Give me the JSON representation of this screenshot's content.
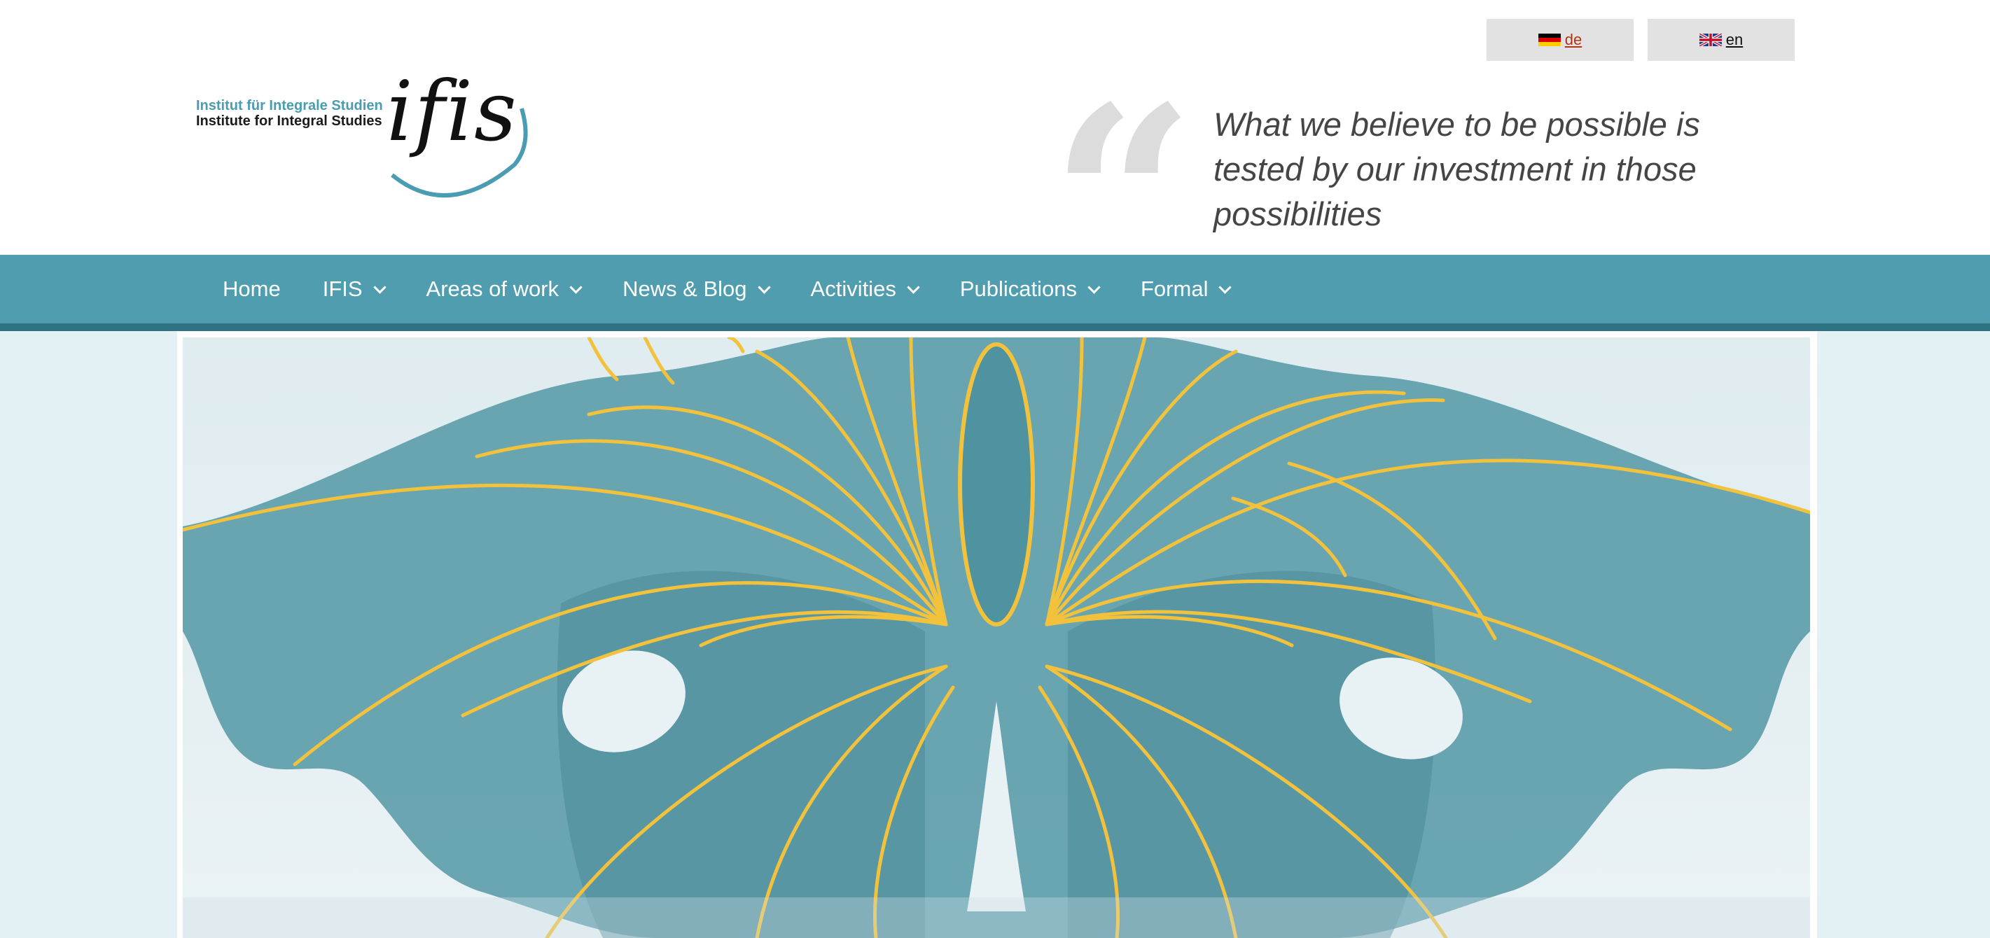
{
  "language_switcher": {
    "de": {
      "label": " de",
      "flag": "germany-flag-icon"
    },
    "en": {
      "label": " en",
      "flag": "uk-flag-icon"
    }
  },
  "logo": {
    "line1": "Institut für Integrale Studien",
    "line2": "Institute for Integral Studies",
    "mark": "ifis"
  },
  "quote": {
    "mark": "“",
    "text": "What we believe to be possible is tested by our investment in those possibilities"
  },
  "nav": {
    "items": [
      {
        "label": "Home",
        "has_dropdown": false
      },
      {
        "label": "IFIS",
        "has_dropdown": true
      },
      {
        "label": "Areas of work",
        "has_dropdown": true
      },
      {
        "label": "News & Blog",
        "has_dropdown": true
      },
      {
        "label": "Activities",
        "has_dropdown": true
      },
      {
        "label": "Publications",
        "has_dropdown": true
      },
      {
        "label": "Formal",
        "has_dropdown": true
      }
    ]
  },
  "colors": {
    "nav_bg": "#509db0",
    "nav_border": "#2f7383",
    "page_bg": "#e3f0f4",
    "butterfly_wing": "#5e9eab",
    "butterfly_veins": "#f2c23c"
  },
  "hero": {
    "image": "butterfly-illustration"
  }
}
